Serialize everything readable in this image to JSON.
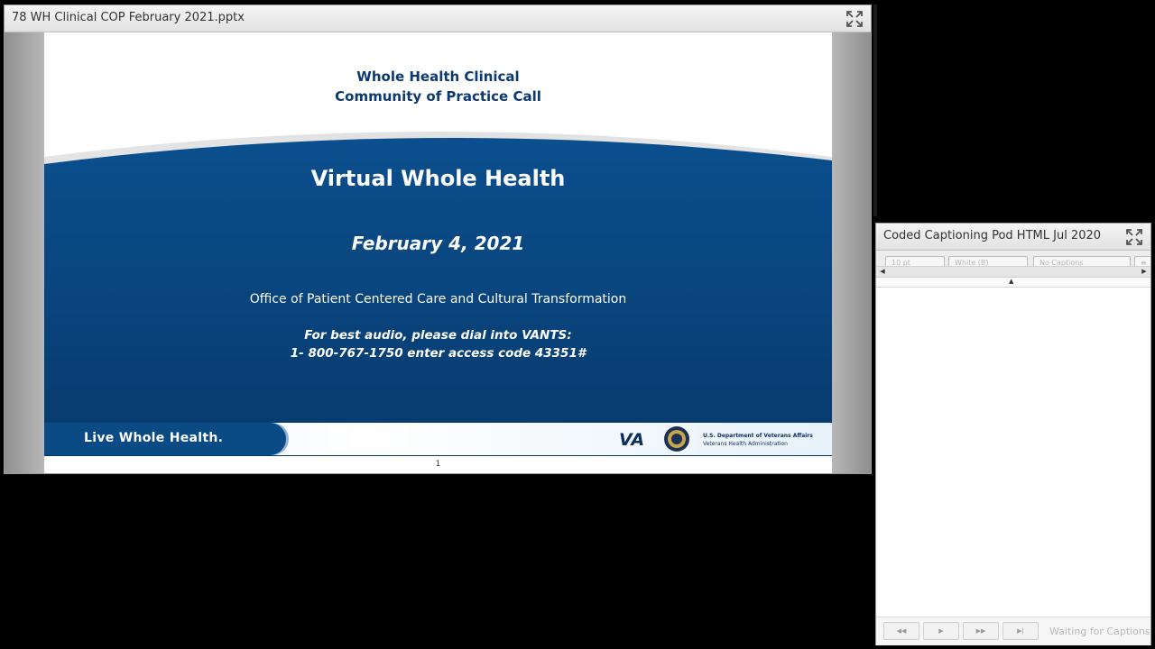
{
  "slide_pod": {
    "title": "78 WH Clinical COP February 2021.pptx",
    "maximize_icon": "maximize-icon"
  },
  "slide": {
    "header_line1": "Whole Health Clinical",
    "header_line2": "Community of Practice Call",
    "title": "Virtual Whole Health",
    "date": "February 4, 2021",
    "office": "Office of Patient Centered Care and Cultural Transformation",
    "audio_line1": "For best audio, please dial into VANTS:",
    "audio_line2": "1- 800-767-1750  enter access code 43351#",
    "footer_brand": "Live Whole Health.",
    "va_logo": "VA",
    "dept_line1": "U.S. Department of Veterans Affairs",
    "dept_line2": "Veterans Health Administration",
    "page_number": "1",
    "colors": {
      "band_blue": "#0a4a85",
      "header_blue": "#0d3a6e"
    }
  },
  "caption_pod": {
    "title": "Coded Captioning Pod HTML Jul 2020",
    "maximize_icon": "maximize-icon",
    "font_size_select": "10 pt",
    "color_select": "White (B)",
    "caption_select": "No Captions",
    "controls": {
      "first": "first-icon",
      "play": "play-icon",
      "next": "fast-forward-icon",
      "last": "last-icon"
    },
    "status": "Waiting for Captions"
  }
}
